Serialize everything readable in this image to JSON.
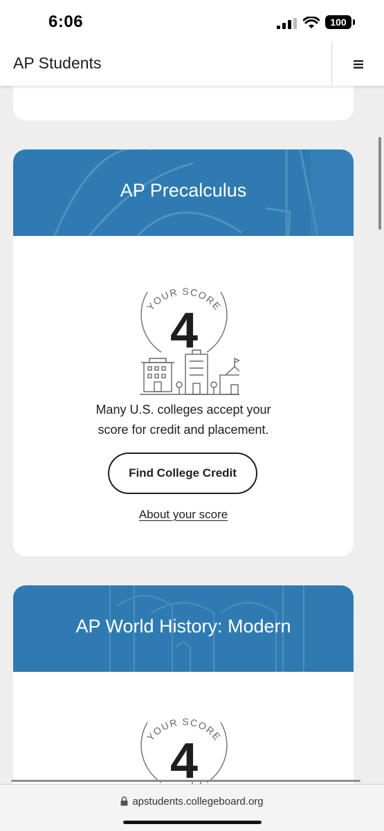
{
  "status_bar": {
    "time": "6:06",
    "battery": "100"
  },
  "header": {
    "title": "AP Students",
    "menu_icon": "hamburger-menu-icon"
  },
  "cards": [
    {
      "title": "AP Precalculus",
      "score_label": "YOUR SCORE",
      "score": "4",
      "description_line1": "Many U.S. colleges accept your",
      "description_line2": "score for credit and placement.",
      "cta_label": "Find College Credit",
      "about_link": "About your score"
    },
    {
      "title": "AP World History: Modern",
      "score_label": "YOUR SCORE",
      "score": "4"
    }
  ],
  "browser": {
    "url": "apstudents.collegeboard.org"
  },
  "colors": {
    "banner": "#2f7bb1",
    "background": "#eeeeee",
    "card": "#ffffff"
  }
}
